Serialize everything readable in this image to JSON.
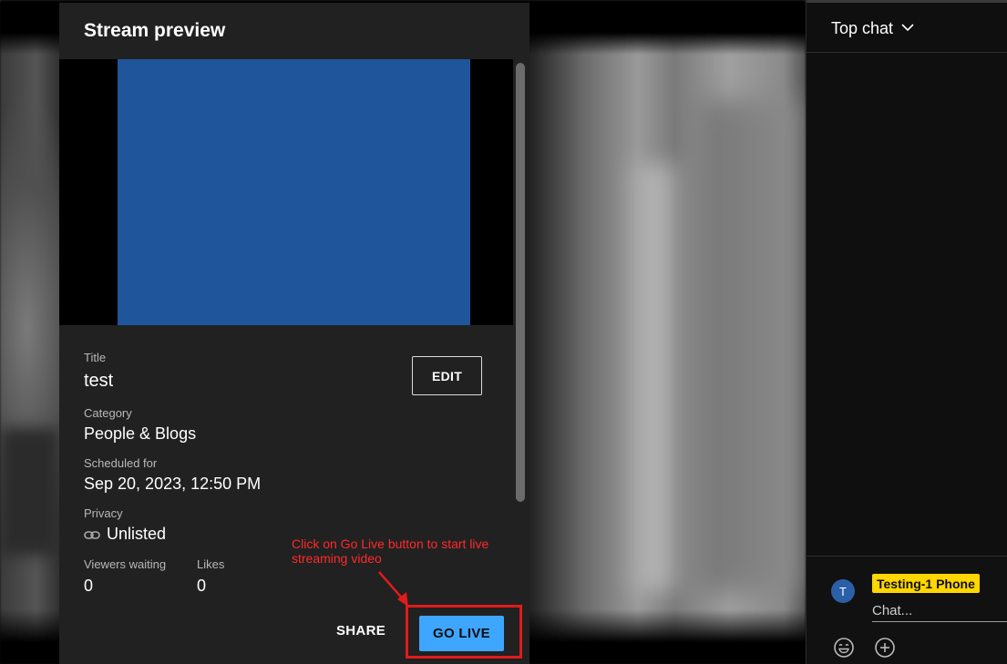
{
  "preview": {
    "title": "Stream preview",
    "fields": {
      "title_label": "Title",
      "title_value": "test",
      "category_label": "Category",
      "category_value": "People & Blogs",
      "scheduled_label": "Scheduled for",
      "scheduled_value": "Sep 20, 2023, 12:50 PM",
      "privacy_label": "Privacy",
      "privacy_value": "Unlisted",
      "viewers_label": "Viewers waiting",
      "viewers_value": "0",
      "likes_label": "Likes",
      "likes_value": "0"
    },
    "edit_label": "EDIT",
    "share_label": "SHARE",
    "golive_label": "GO LIVE"
  },
  "annotation": {
    "text": "Click on Go Live button to start live streaming video",
    "color": "#e01b1b"
  },
  "chat": {
    "title": "Top chat",
    "avatar_initial": "T",
    "user_name": "Testing-1 Phone",
    "input_placeholder": "Chat..."
  },
  "colors": {
    "accent": "#3ea6ff",
    "badge": "#ffd600",
    "panel": "#212121"
  },
  "icons": {
    "chevron": "chevron-down-icon",
    "privacy": "link-icon",
    "emoji": "emoji-icon",
    "add": "plus-circle-icon"
  }
}
